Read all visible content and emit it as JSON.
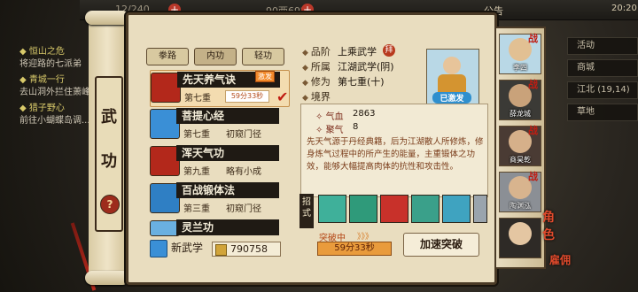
{
  "topbar": {
    "food": "12/240",
    "money": "90两69文",
    "notice": "公告",
    "clock": "20:20"
  },
  "quests": [
    {
      "title": "◆ 恒山之危",
      "sub": "将迎路的七派弟"
    },
    {
      "title": "◆ 青城一行",
      "sub": "去山洞外拦住萧峰"
    },
    {
      "title": "◆ 猎子野心",
      "sub": "前往小蝴蝶岛调..."
    }
  ],
  "right_list": [
    "活动",
    "商城",
    "江北",
    "草地"
  ],
  "right_list_extra": "(19,14)",
  "scroll": {
    "chars": [
      "武",
      "功"
    ],
    "help": "?"
  },
  "tabs": [
    "拳路",
    "内功",
    "轻功"
  ],
  "skills": [
    {
      "name": "先天养气诀",
      "level": "第七重",
      "rank": "",
      "timer": "59分33秒",
      "selected": true,
      "activated": "激发",
      "icon_color": "#b3281b"
    },
    {
      "name": "菩提心经",
      "level": "第七重",
      "rank": "初窥门径",
      "icon_color": "#3a8fd6"
    },
    {
      "name": "浑天气功",
      "level": "第九重",
      "rank": "略有小成",
      "icon_color": "#b3281b"
    },
    {
      "name": "百战锻体法",
      "level": "第三重",
      "rank": "初窥门径",
      "icon_color": "#2f7fc4"
    },
    {
      "name": "灵兰功",
      "level": "",
      "rank": "",
      "icon_color": "#6ab0e0"
    }
  ],
  "new_skill": "新武学",
  "coins": "790758",
  "info": {
    "grade_label": "品阶",
    "grade_value": "上乘武学",
    "grade_badge": "拜",
    "affiliation_label": "所属",
    "affiliation_value": "江湖武学(阴)",
    "cultivation_label": "修为",
    "cultivation_value": "第七重(十)",
    "realm_label": "境界",
    "realm_value": ""
  },
  "portrait_tag": "已激发",
  "stats": [
    {
      "label": "气血",
      "value": "2863"
    },
    {
      "label": "聚气",
      "value": "8"
    }
  ],
  "description": "先天气源于丹经典籍，后为江湖散人所修炼，修身炼气过程中的所产生的能量，主重锻体之功效，能够大幅提高肉体的抗性和攻击性。",
  "moves_label": "招式",
  "moves": [
    {
      "icon_color": "#3fb09a"
    },
    {
      "icon_color": "#2f9a7a"
    },
    {
      "icon_color": "#c8312a"
    },
    {
      "icon_color": "#3aa08a"
    },
    {
      "icon_color": "#3fa3c0"
    },
    {
      "icon_color": "#9aa4ad"
    }
  ],
  "breakthrough": {
    "label": "突破中",
    "arrows": "》》》",
    "timer": "59分33秒",
    "speed_button": "加速突破"
  },
  "characters": [
    {
      "name": "李四",
      "face": "#e2c093",
      "bg": "#b9d8e6"
    },
    {
      "name": "薛龙城",
      "face": "#c9a27a",
      "bg": "#3b3a36"
    },
    {
      "name": "商昊乾",
      "face": "#d6b08a",
      "bg": "#4a3b34"
    },
    {
      "name": "陶渊泓",
      "face": "#d8b48e",
      "bg": "#8b8f95"
    },
    {
      "name": "",
      "face": "#e4c6a2",
      "bg": "#2e2a26"
    }
  ],
  "battle_mark": "战",
  "role_button": [
    "角",
    "色"
  ],
  "hire_button": [
    "雇",
    "佣"
  ]
}
